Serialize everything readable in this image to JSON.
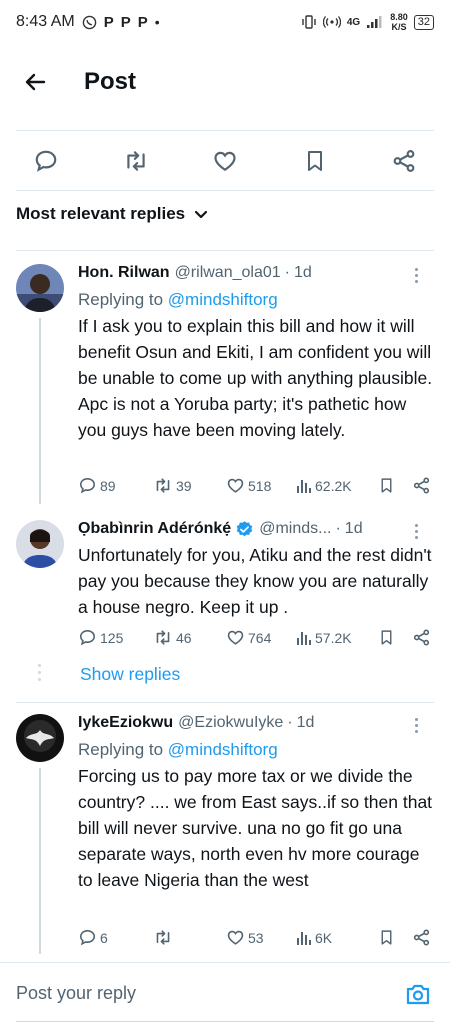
{
  "status_bar": {
    "time": "8:43 AM",
    "notif_icons": [
      "P",
      "P",
      "P"
    ],
    "net": "4G",
    "speed_top": "8.80",
    "speed_bottom": "K/S",
    "battery": "32"
  },
  "header": {
    "title": "Post"
  },
  "sort": {
    "label": "Most relevant replies"
  },
  "replies": [
    {
      "name": "Hon. Rilwan",
      "handle": "@rilwan_ola01",
      "time": "1d",
      "replying_prefix": "Replying to",
      "replying_to": "@mindshiftorg",
      "text": "If I ask you to explain this bill and how it will benefit Osun and Ekiti, I am confident you will be unable to come up with anything plausible. Apc is not a Yoruba party; it's pathetic how you guys have been moving lately.",
      "comments": "89",
      "reposts": "39",
      "likes": "518",
      "views": "62.2K"
    },
    {
      "name": "Ọbabìnrin Adérónkẹ́",
      "handle": "@minds...",
      "time": "1d",
      "text": "Unfortunately for you, Atiku and the rest didn't pay you because they know you are naturally a house negro. Keep it up .",
      "comments": "125",
      "reposts": "46",
      "likes": "764",
      "views": "57.2K"
    },
    {
      "name": "IykeEziokwu",
      "handle": "@EziokwuIyke",
      "time": "1d",
      "replying_prefix": "Replying to",
      "replying_to": "@mindshiftorg",
      "text": "Forcing us to pay more tax or we divide the country? .... we from East says..if so then that bill will never survive.  una no go fit go una separate ways, north even hv more courage to leave Nigeria than the west",
      "comments": "6",
      "reposts": "",
      "likes": "53",
      "views": "6K"
    }
  ],
  "show_replies": "Show replies",
  "compose": {
    "placeholder": "Post your reply"
  },
  "colors": {
    "accent": "#1d9bf0",
    "text": "#0f1419",
    "muted": "#536471",
    "border": "#e1e8ed"
  }
}
